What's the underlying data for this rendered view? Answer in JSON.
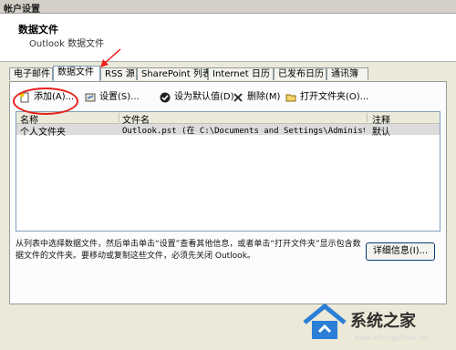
{
  "window": {
    "title": "帐户设置"
  },
  "header": {
    "title": "数据文件",
    "subtitle": "Outlook 数据文件"
  },
  "tabs": [
    {
      "label": "电子邮件"
    },
    {
      "label": "数据文件"
    },
    {
      "label": "RSS 源"
    },
    {
      "label": "SharePoint 列表"
    },
    {
      "label": "Internet 日历"
    },
    {
      "label": "已发布日历"
    },
    {
      "label": "通讯簿"
    }
  ],
  "toolbar": {
    "add": "添加(A)...",
    "settings": "设置(S)...",
    "set_default": "设为默认值(D)",
    "remove": "删除(M)",
    "open_folder": "打开文件夹(O)..."
  },
  "list": {
    "columns": [
      "名称",
      "文件名",
      "注释"
    ],
    "rows": [
      {
        "name": "个人文件夹",
        "file": "Outlook.pst (在 C:\\Documents and Settings\\Administra...",
        "comment": "默认"
      }
    ]
  },
  "description": "从列表中选择数据文件，然后单击单击“设置”查看其他信息，或者单击“打开文件夹”显示包含数据文件的文件夹。要移动或复制这些文件，必须先关闭 Outlook。",
  "buttons": {
    "details": "详细信息(I)..."
  },
  "watermark": {
    "text": "系统之家",
    "url": "www.xitongzhijia.net"
  },
  "colors": {
    "annotation": "#e8201c",
    "tab_active_border": "#7f9db9"
  }
}
